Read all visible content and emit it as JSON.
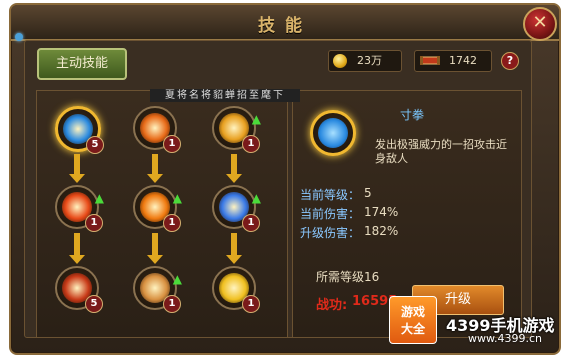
{
  "window": {
    "title": "技能",
    "close_glyph": "✕"
  },
  "tabs": [
    {
      "label": "主动技能",
      "active": true
    }
  ],
  "resources": {
    "gold": "23万",
    "scroll": "1742"
  },
  "help_glyph": "?",
  "banner": "夏将名将貂蝉招至麾下",
  "skills": [
    {
      "row": 0,
      "col": 0,
      "level": "5",
      "upgradable": false,
      "selected": true,
      "color": "#2a8ae0",
      "icon": "fist-icon"
    },
    {
      "row": 0,
      "col": 1,
      "level": "1",
      "upgradable": false,
      "selected": false,
      "color": "#e86a18",
      "icon": "claw-icon"
    },
    {
      "row": 0,
      "col": 2,
      "level": "1",
      "upgradable": true,
      "selected": false,
      "color": "#e8a020",
      "icon": "flame-hand-icon"
    },
    {
      "row": 1,
      "col": 0,
      "level": "1",
      "upgradable": true,
      "selected": false,
      "color": "#e84a18",
      "icon": "fire-wave-icon"
    },
    {
      "row": 1,
      "col": 1,
      "level": "1",
      "upgradable": true,
      "selected": false,
      "color": "#f07a10",
      "icon": "fire-burst-icon"
    },
    {
      "row": 1,
      "col": 2,
      "level": "1",
      "upgradable": true,
      "selected": false,
      "color": "#3a7ae8",
      "icon": "lightning-icon"
    },
    {
      "row": 2,
      "col": 0,
      "level": "5",
      "upgradable": false,
      "selected": false,
      "color": "#c83a18",
      "icon": "warrior-icon"
    },
    {
      "row": 2,
      "col": 1,
      "level": "1",
      "upgradable": true,
      "selected": false,
      "color": "#d89040",
      "icon": "scroll-icon"
    },
    {
      "row": 2,
      "col": 2,
      "level": "1",
      "upgradable": false,
      "selected": false,
      "color": "#f0c020",
      "icon": "light-beam-icon"
    }
  ],
  "detail": {
    "name": "寸拳",
    "description": "发出极强威力的一招攻击近身敌人",
    "current_level_label": "当前等级：",
    "current_level": "5",
    "current_damage_label": "当前伤害：",
    "current_damage": "174%",
    "next_damage_label": "升级伤害：",
    "next_damage": "182%",
    "required_level": "所需等级16",
    "power_label": "战功:",
    "power_value": "16595",
    "upgrade_button": "升级"
  },
  "watermark": {
    "text": "4399手机游戏",
    "url": "www.4399.cn",
    "logo_top": "游戏",
    "logo_bottom": "大全"
  },
  "colors": {
    "accent": "#e0a820",
    "power_red": "#e02a1a",
    "upgrade_green": "#4adb3a"
  }
}
